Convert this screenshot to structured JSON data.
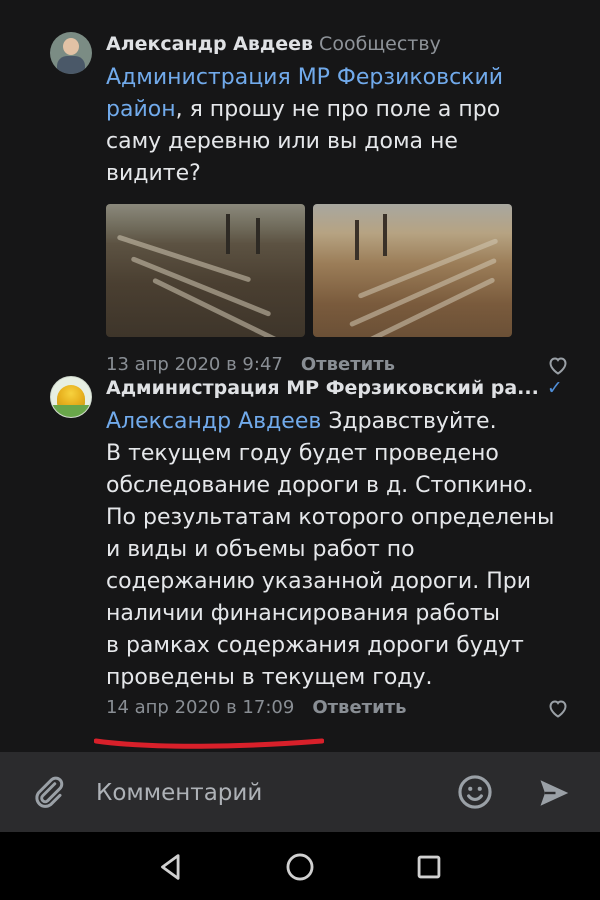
{
  "comments": [
    {
      "author": "Александр Авдеев",
      "target": "Сообществу",
      "mention": "Администрация МР Ферзиковский район",
      "text": ", я прошу не про поле а про саму деревню или вы дома не видите?",
      "date": "13 апр 2020 в 9:47",
      "reply_label": "Ответить",
      "photos": [
        "muddy-road-photo",
        "rutted-road-photo"
      ]
    },
    {
      "author": "Администрация МР Ферзиковский ра...",
      "verified_icon": "check-verified-icon",
      "mention": "Александр Авдеев",
      "text_lines": [
        " Здравствуйте.",
        "В текущем году будет проведено",
        "обследование дороги в д. Стопкино.",
        "По результатам которого определены",
        "и виды и объемы работ по",
        "содержанию указанной дороги. При",
        "наличии финансирования работы",
        "в рамках содержания дороги будут",
        "проведены в текущем году."
      ],
      "date": "14 апр 2020 в 17:09",
      "reply_label": "Ответить"
    }
  ],
  "composer": {
    "placeholder": "Комментарий",
    "icons": [
      "attach-icon",
      "emoji-icon",
      "send-icon"
    ]
  },
  "navbar": {
    "icons": [
      "back-icon",
      "home-icon",
      "recents-icon"
    ]
  },
  "colors": {
    "background": "#161617",
    "mention": "#71aaeb",
    "meta": "#898e94",
    "underline": "#d8202a",
    "composer": "#2b2b2d"
  }
}
